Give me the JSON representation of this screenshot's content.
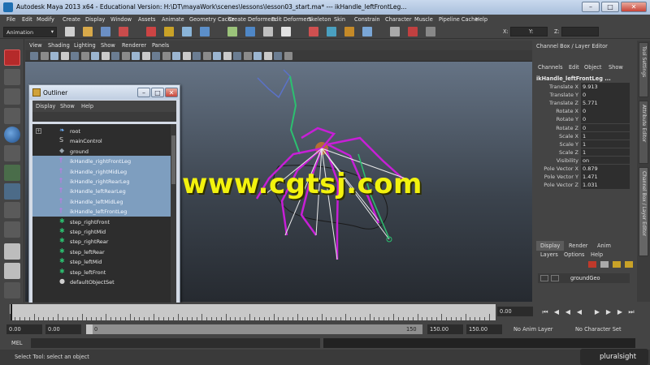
{
  "window": {
    "title": "Autodesk Maya 2013 x64 - Educational Version: H:\\DT\\mayaWork\\scenes\\lessons\\lesson03_start.ma*   ---   ikHandle_leftFrontLeg...",
    "minimize": "–",
    "maximize": "□",
    "close": "✕"
  },
  "menubar": [
    "File",
    "Edit",
    "Modify",
    "Create",
    "Display",
    "Window",
    "Assets",
    "Animate",
    "Geometry Cache",
    "Create Deformers",
    "Edit Deformers",
    "Skeleton",
    "Skin",
    "Constrain",
    "Character",
    "Muscle",
    "Pipeline Cache",
    "Help"
  ],
  "statusline": {
    "mode": "Animation",
    "x_label": "X:",
    "y_label": "Y:",
    "z_label": "Z:"
  },
  "viewport": {
    "menu": [
      "View",
      "Shading",
      "Lighting",
      "Show",
      "Renderer",
      "Panels"
    ]
  },
  "watermark": "www.cgtsj.com",
  "outliner": {
    "title": "Outliner",
    "menu": [
      "Display",
      "Show",
      "Help"
    ],
    "items": [
      {
        "label": "root",
        "icon": "joint-icon",
        "selected": false,
        "expandable": true
      },
      {
        "label": "mainControl",
        "icon": "curve-icon",
        "selected": false,
        "expandable": false
      },
      {
        "label": "ground",
        "icon": "mesh-icon",
        "selected": false,
        "expandable": false
      },
      {
        "label": "ikHandle_rightFrontLeg",
        "icon": "ikhandle-icon",
        "selected": true,
        "expandable": false
      },
      {
        "label": "ikHandle_rightMidLeg",
        "icon": "ikhandle-icon",
        "selected": true,
        "expandable": false
      },
      {
        "label": "ikHandle_rightRearLeg",
        "icon": "ikhandle-icon",
        "selected": true,
        "expandable": false
      },
      {
        "label": "ikHandle_leftRearLeg",
        "icon": "ikhandle-icon",
        "selected": true,
        "expandable": false
      },
      {
        "label": "ikHandle_leftMidLeg",
        "icon": "ikhandle-icon",
        "selected": true,
        "expandable": false
      },
      {
        "label": "ikHandle_leftFrontLeg",
        "icon": "ikhandle-icon",
        "selected": true,
        "expandable": false
      },
      {
        "label": "step_rightFront",
        "icon": "locator-icon",
        "selected": false,
        "expandable": false
      },
      {
        "label": "step_rightMid",
        "icon": "locator-icon",
        "selected": false,
        "expandable": false
      },
      {
        "label": "step_rightRear",
        "icon": "locator-icon",
        "selected": false,
        "expandable": false
      },
      {
        "label": "step_leftRear",
        "icon": "locator-icon",
        "selected": false,
        "expandable": false
      },
      {
        "label": "step_leftMid",
        "icon": "locator-icon",
        "selected": false,
        "expandable": false
      },
      {
        "label": "step_leftFront",
        "icon": "locator-icon",
        "selected": false,
        "expandable": false
      },
      {
        "label": "defaultObjectSet",
        "icon": "set-icon",
        "selected": false,
        "expandable": false
      }
    ]
  },
  "channelbox": {
    "header": "Channel Box / Layer Editor",
    "menu": [
      "Channels",
      "Edit",
      "Object",
      "Show"
    ],
    "object": "ikHandle_leftFrontLeg ...",
    "channels": [
      {
        "name": "Translate X",
        "value": "9.913"
      },
      {
        "name": "Translate Y",
        "value": "0"
      },
      {
        "name": "Translate Z",
        "value": "5.771"
      },
      {
        "name": "Rotate X",
        "value": "0"
      },
      {
        "name": "Rotate Y",
        "value": "0"
      },
      {
        "name": "Rotate Z",
        "value": "0"
      },
      {
        "name": "Scale X",
        "value": "1"
      },
      {
        "name": "Scale Y",
        "value": "1"
      },
      {
        "name": "Scale Z",
        "value": "1"
      },
      {
        "name": "Visibility",
        "value": "on"
      },
      {
        "name": "Pole Vector X",
        "value": "0.879"
      },
      {
        "name": "Pole Vector Y",
        "value": "1.471"
      },
      {
        "name": "Pole Vector Z",
        "value": "1.031"
      }
    ],
    "layer_tabs": [
      "Display",
      "Render",
      "Anim"
    ],
    "layer_menu": [
      "Layers",
      "Options",
      "Help"
    ],
    "layer": "groundGeo"
  },
  "side_tabs": [
    "Tool Settings",
    "Attribute Editor",
    "Channel Box / Layer Editor"
  ],
  "timeslider": {
    "current_frame": "0.00"
  },
  "range": {
    "start": "0.00",
    "inner_start": "0.00",
    "frame_field": "0",
    "range_start": "0",
    "range_end": "150",
    "end": "150.00",
    "outer_end": "150.00",
    "anim_layer": "No Anim Layer",
    "character": "No Character Set"
  },
  "cmdline": {
    "label": "MEL"
  },
  "helpline": {
    "text": "Select Tool: select an object",
    "brand": "pluralsight"
  }
}
